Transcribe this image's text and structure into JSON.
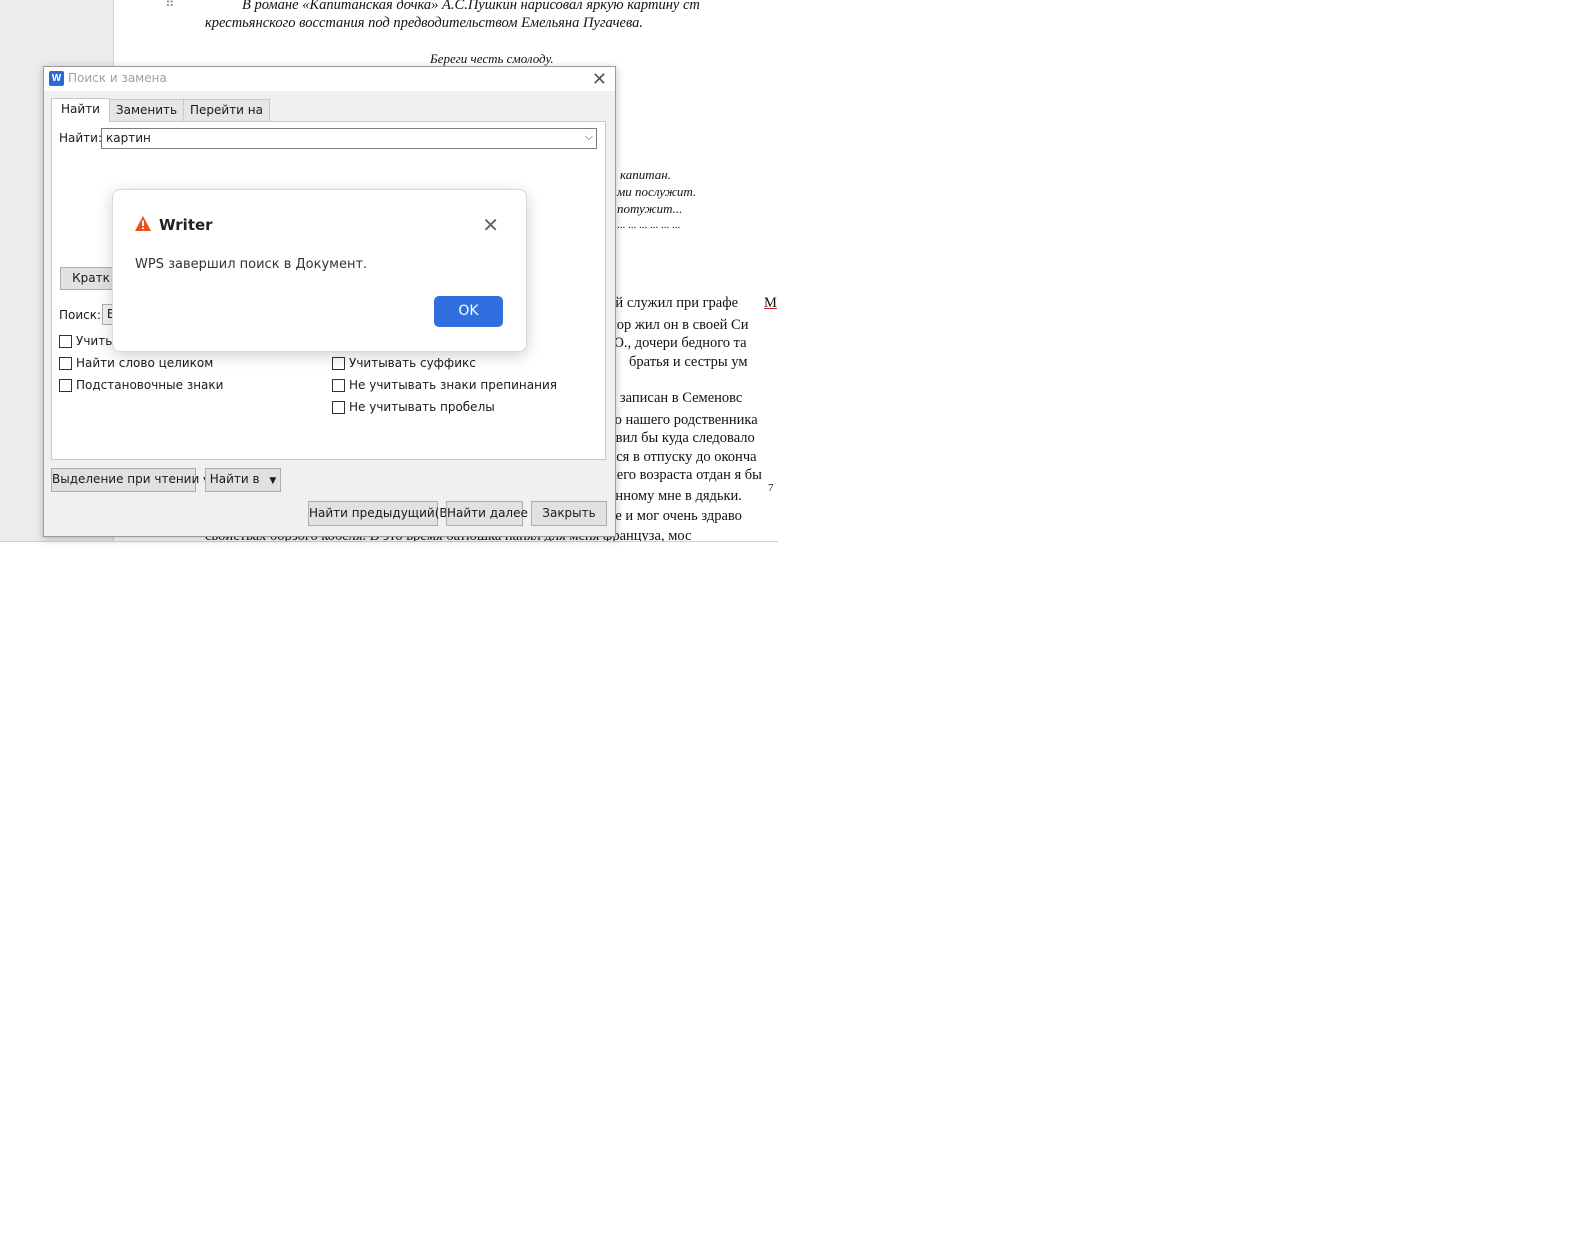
{
  "document": {
    "lines": [
      "В романе «Капитанская дочка» А.С.Пушкин нарисовал яркую картину ст",
      "крестьянского восстания под предводительством Емельяна Пугачева.",
      "Береги честь смолоду.",
      "капитан.",
      "ми послужит.",
      "потужит...",
      "... ... ... ... ... ...",
      "ей служил при графе",
      "М",
      "пор жил он в своей Си",
      "Ю., дочери бедного та",
      "братья и сестры ум",
      "л записан в Семеновс",
      "го нашего родственника",
      "явил бы куда следовало",
      "лся в отпуску до оконча",
      "него возраста отдан я бы",
      "анному мне в дядьки.",
      "7",
      "те и мог очень здраво",
      "свойствах борзого кобеля. В это время батюшка нанял для меня француза, мос"
    ]
  },
  "find_dialog": {
    "app_icon": "W",
    "title": "Поиск и замена",
    "tabs": [
      "Найти",
      "Заменить",
      "Перейти на"
    ],
    "find_label": "Найти:",
    "find_value": "картин",
    "brief_button": "Кратк",
    "search_label": "Поиск:",
    "search_value": "В",
    "checkboxes_left": [
      "Учиты",
      "Найти слово целиком",
      "Подстановочные знаки"
    ],
    "checkboxes_right": [
      "Учитывать суффикс",
      "Не учитывать знаки препинания",
      "Не учитывать пробелы"
    ],
    "highlight_button": "Выделение при чтении",
    "find_in_button": "Найти в",
    "prev_button": "Найти предыдущий(B)",
    "next_button": "Найти далее",
    "close_button": "Закрыть"
  },
  "alert": {
    "title": "Writer",
    "message": "WPS завершил поиск в Документ.",
    "ok_label": "OK"
  },
  "colors": {
    "accent": "#2f6fe0",
    "warning": "#e8501e"
  }
}
